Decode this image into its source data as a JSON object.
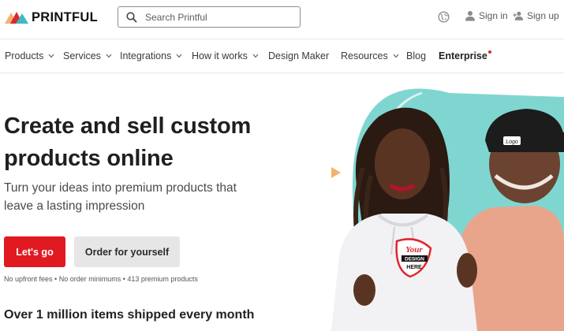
{
  "header": {
    "brand": "PRINTFUL",
    "search": {
      "placeholder": "Search Printful",
      "value": ""
    },
    "sign_in": "Sign in",
    "sign_up": "Sign up"
  },
  "nav": {
    "items": [
      {
        "label": "Products",
        "has_dropdown": true
      },
      {
        "label": "Services",
        "has_dropdown": true
      },
      {
        "label": "Integrations",
        "has_dropdown": true
      },
      {
        "label": "How it works",
        "has_dropdown": true
      },
      {
        "label": "Design Maker",
        "has_dropdown": false
      },
      {
        "label": "Resources",
        "has_dropdown": true
      },
      {
        "label": "Blog",
        "has_dropdown": false
      },
      {
        "label": "Enterprise",
        "has_dropdown": false
      }
    ]
  },
  "hero": {
    "title_line1": "Create and sell custom",
    "title_line2": "products online",
    "subtitle_line1": "Turn your ideas into premium products that",
    "subtitle_line2": "leave a lasting impression",
    "primary_cta": "Let's go",
    "secondary_cta": "Order for yourself",
    "fine_print": "No upfront fees • No order minimums • 413 premium products",
    "stat": "Over 1 million items shipped every month"
  },
  "art": {
    "hoodie_print_line1": "Your",
    "hoodie_print_line2": "DESIGN",
    "hoodie_print_line3": "HERE",
    "cap_patch": "Logo"
  },
  "colors": {
    "brand_red": "#e11a22",
    "teal": "#7fd6d1",
    "secondary_button": "#e6e6e6",
    "accent_orange": "#f2b36b"
  },
  "icons": [
    "logo-mark-icon",
    "search-icon",
    "globe-icon",
    "user-icon",
    "user-plus-icon",
    "chevron-down-icon",
    "play-triangle-icon"
  ]
}
